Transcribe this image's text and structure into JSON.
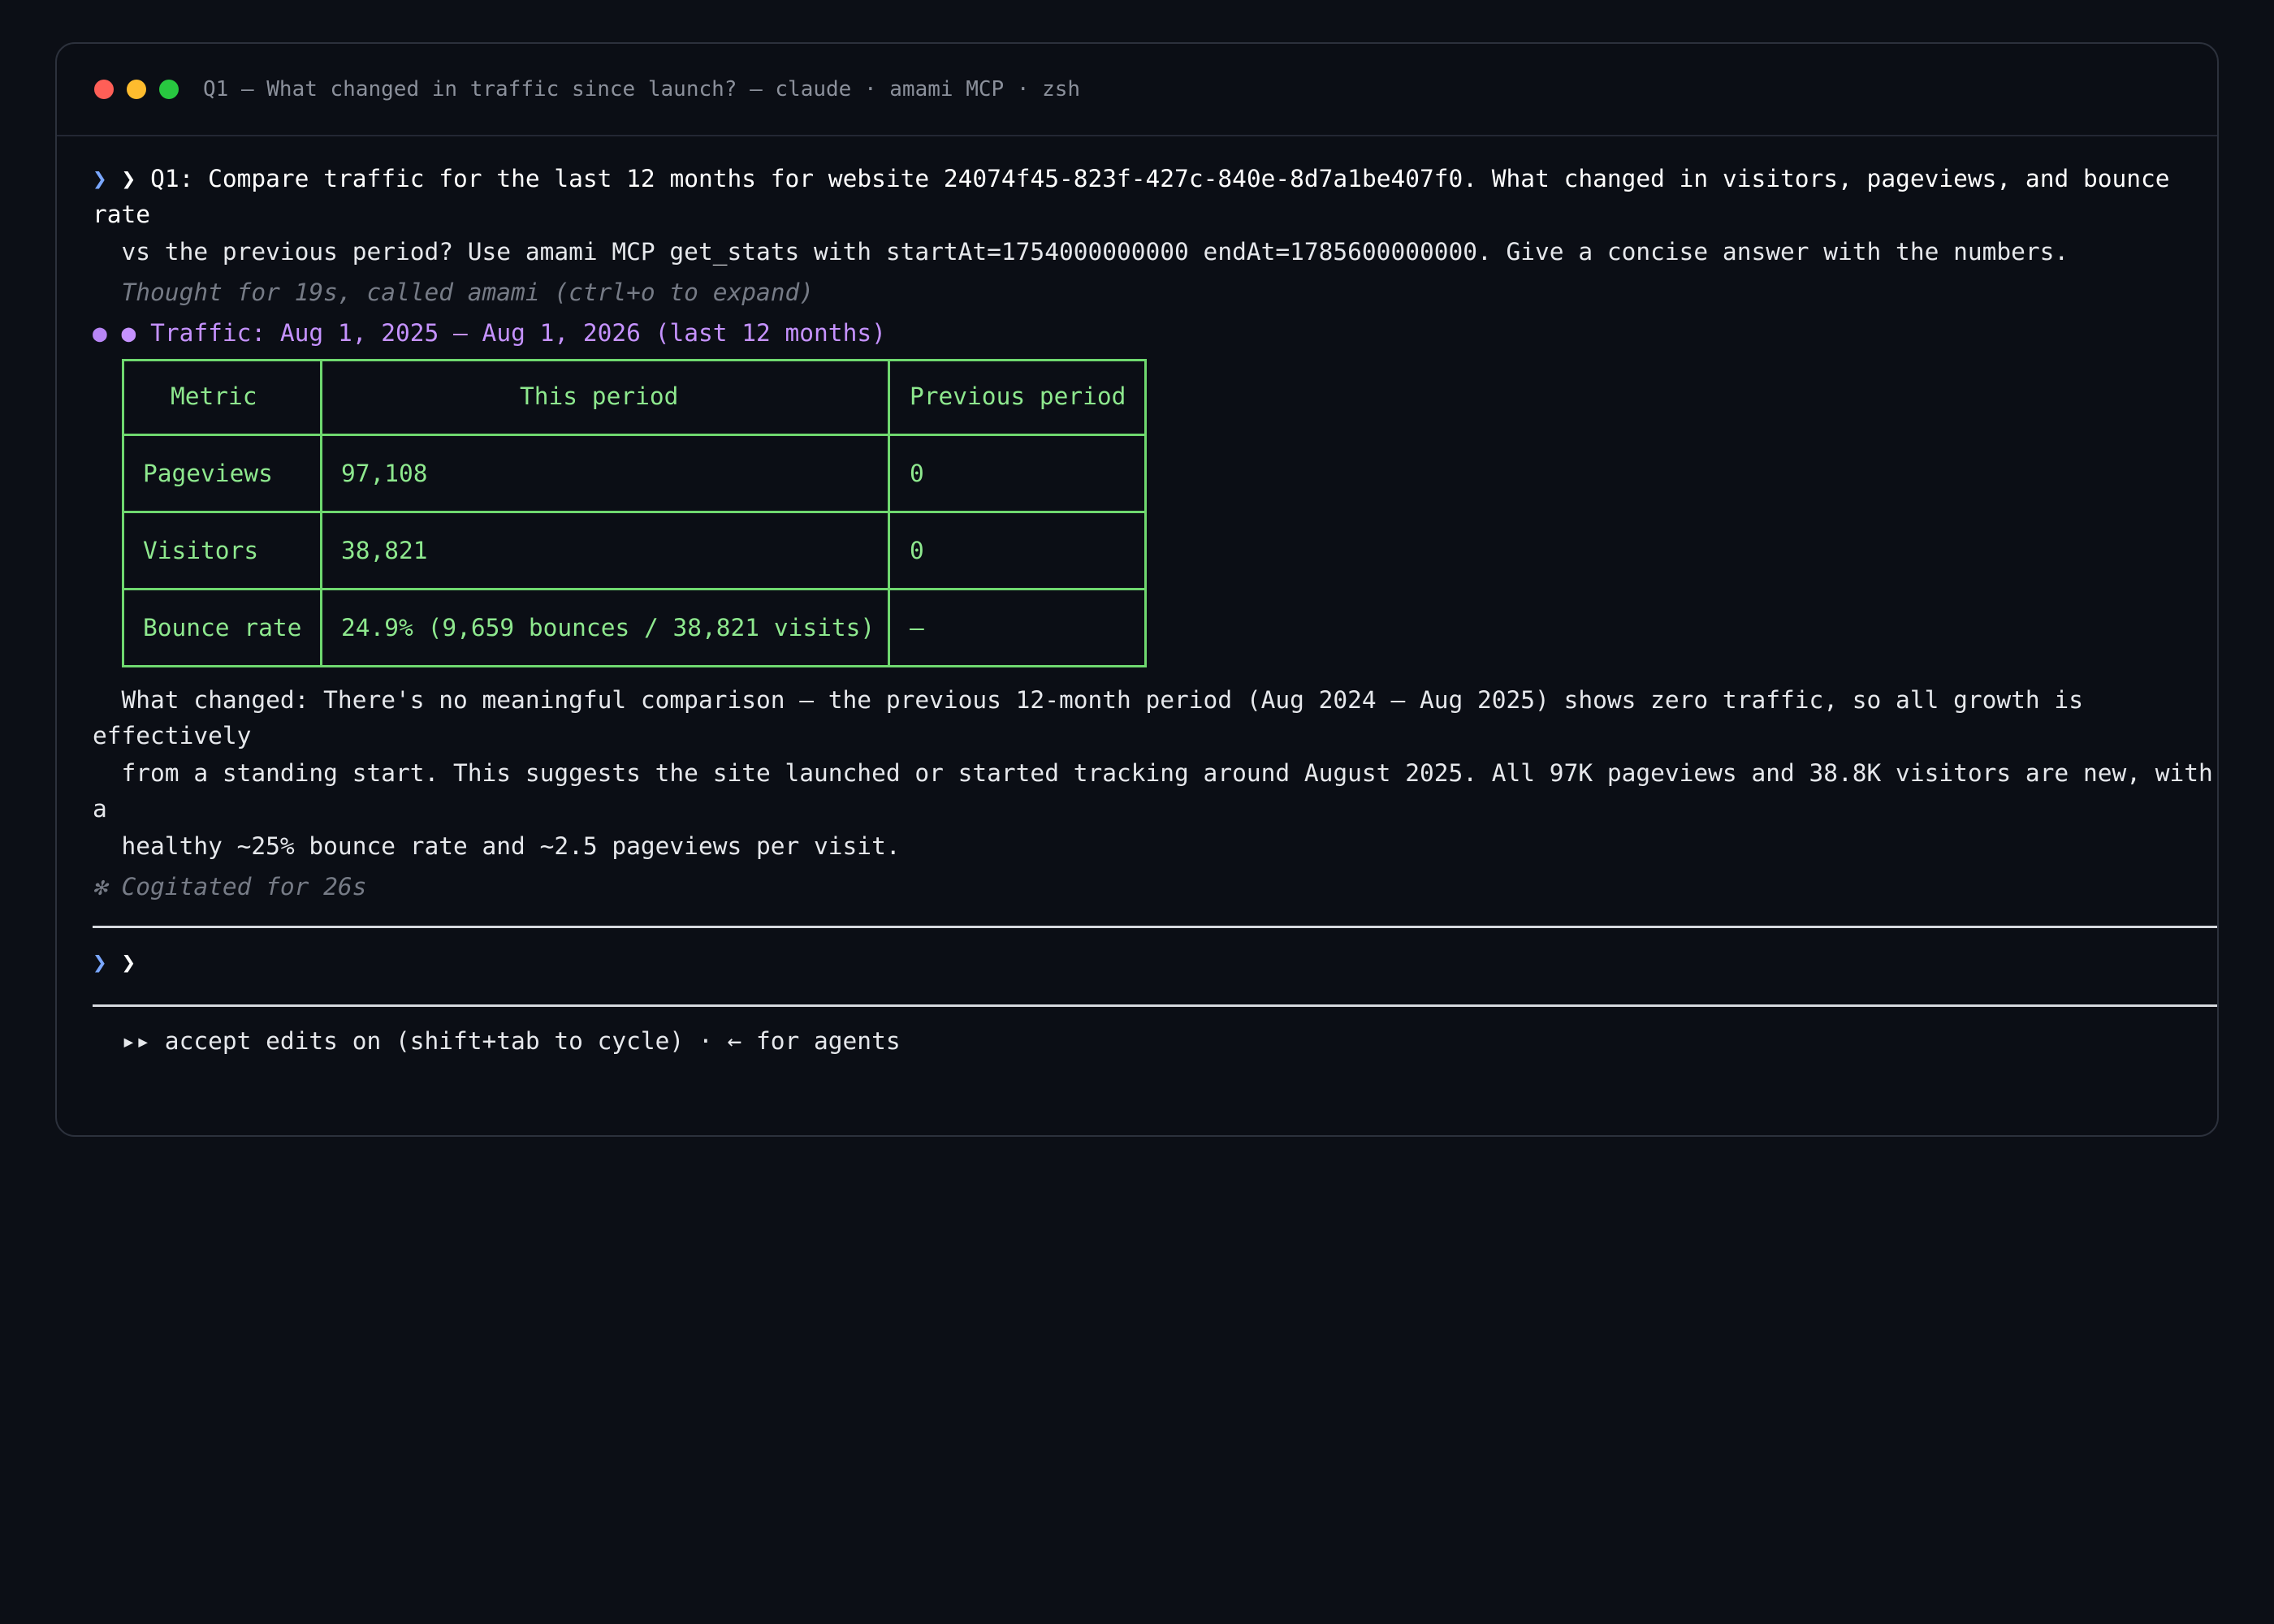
{
  "window": {
    "title": "Q1 — What changed in traffic since launch? — claude · amami MCP · zsh"
  },
  "prompt": {
    "chevron_outer": "❯",
    "chevron_inner": "❯",
    "line1": "Q1: Compare traffic for the last 12 months for website 24074f45-823f-427c-840e-8d7a1be407f0. What changed in visitors, pageviews, and bounce",
    "line1_wrap": "rate",
    "line2": "  vs the previous period? Use amami MCP get_stats with startAt=1754000000000 endAt=1785600000000. Give a concise answer with the numbers."
  },
  "thought": "  Thought for 19s, called amami (ctrl+o to expand)",
  "response": {
    "bullet_outer": "●",
    "bullet_inner": "●",
    "heading": "Traffic: Aug 1, 2025 – Aug 1, 2026 (last 12 months)"
  },
  "table": {
    "headers": [
      "Metric",
      "This period",
      "Previous period"
    ],
    "rows": [
      [
        "Pageviews",
        "97,108",
        "0"
      ],
      [
        "Visitors",
        "38,821",
        "0"
      ],
      [
        "Bounce rate",
        "24.9% (9,659 bounces / 38,821 visits)",
        "–"
      ]
    ]
  },
  "summary": {
    "line1": "  What changed: There's no meaningful comparison — the previous 12-month period (Aug 2024 – Aug 2025) shows zero traffic, so all growth is",
    "line1_wrap": "effectively",
    "line2": "  from a standing start. This suggests the site launched or started tracking around August 2025. All 97K pageviews and 38.8K visitors are new, with",
    "line2_wrap": "a",
    "line3": "  healthy ~25% bounce rate and ~2.5 pageviews per visit."
  },
  "cogitated": "✻ Cogitated for 26s",
  "input": {
    "chevron_outer": "❯",
    "chevron_inner": "❯",
    "value": ""
  },
  "footer": {
    "hint": "  ▸▸ accept edits on (shift+tab to cycle) · ← for agents"
  },
  "colors": {
    "background": "#0c0f16",
    "table_green": "#8ee88e",
    "heading_purple": "#c592ff",
    "prompt_blue": "#7aa7ff"
  }
}
